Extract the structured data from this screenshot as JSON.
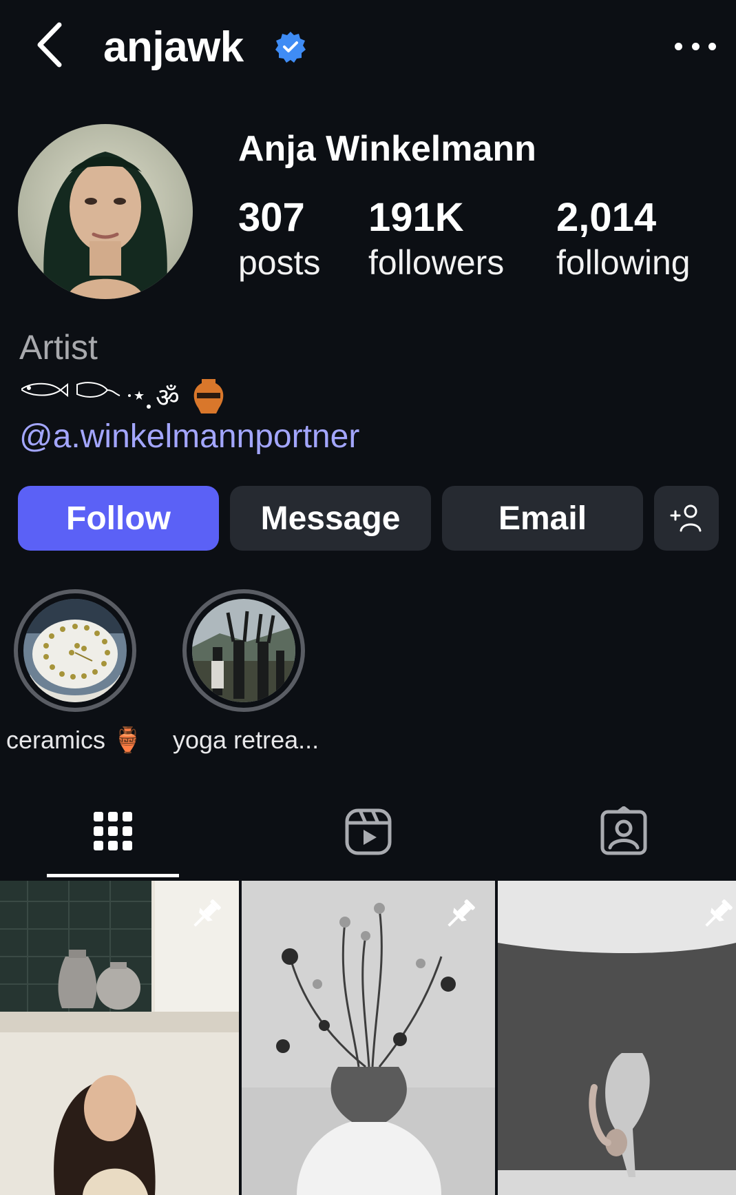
{
  "header": {
    "username": "anjawk",
    "back_icon": "chevron-left-icon",
    "verified_icon": "verified-badge-icon",
    "more_icon": "more-horizontal-icon"
  },
  "profile": {
    "full_name": "Anja Winkelmann",
    "stats": [
      {
        "value": "307",
        "label": "posts"
      },
      {
        "value": "191K",
        "label": "followers"
      },
      {
        "value": "2,014",
        "label": "following"
      }
    ],
    "category": "Artist",
    "bio_line": "fish, flower, sparkle, om, amphora emoji",
    "link": "@a.winkelmannportner"
  },
  "actions": {
    "follow": "Follow",
    "message": "Message",
    "email": "Email",
    "add_user_icon": "add-user-icon"
  },
  "highlights": [
    {
      "label": "ceramics 🏺"
    },
    {
      "label": "yoga retrea..."
    }
  ],
  "tabs": [
    "grid-icon",
    "reels-icon",
    "tagged-icon"
  ],
  "colors": {
    "background": "#0c0f14",
    "follow_button": "#5b61f6",
    "secondary_button": "#262a31",
    "link": "#a3a6ff",
    "verified": "#3f8cf5"
  }
}
